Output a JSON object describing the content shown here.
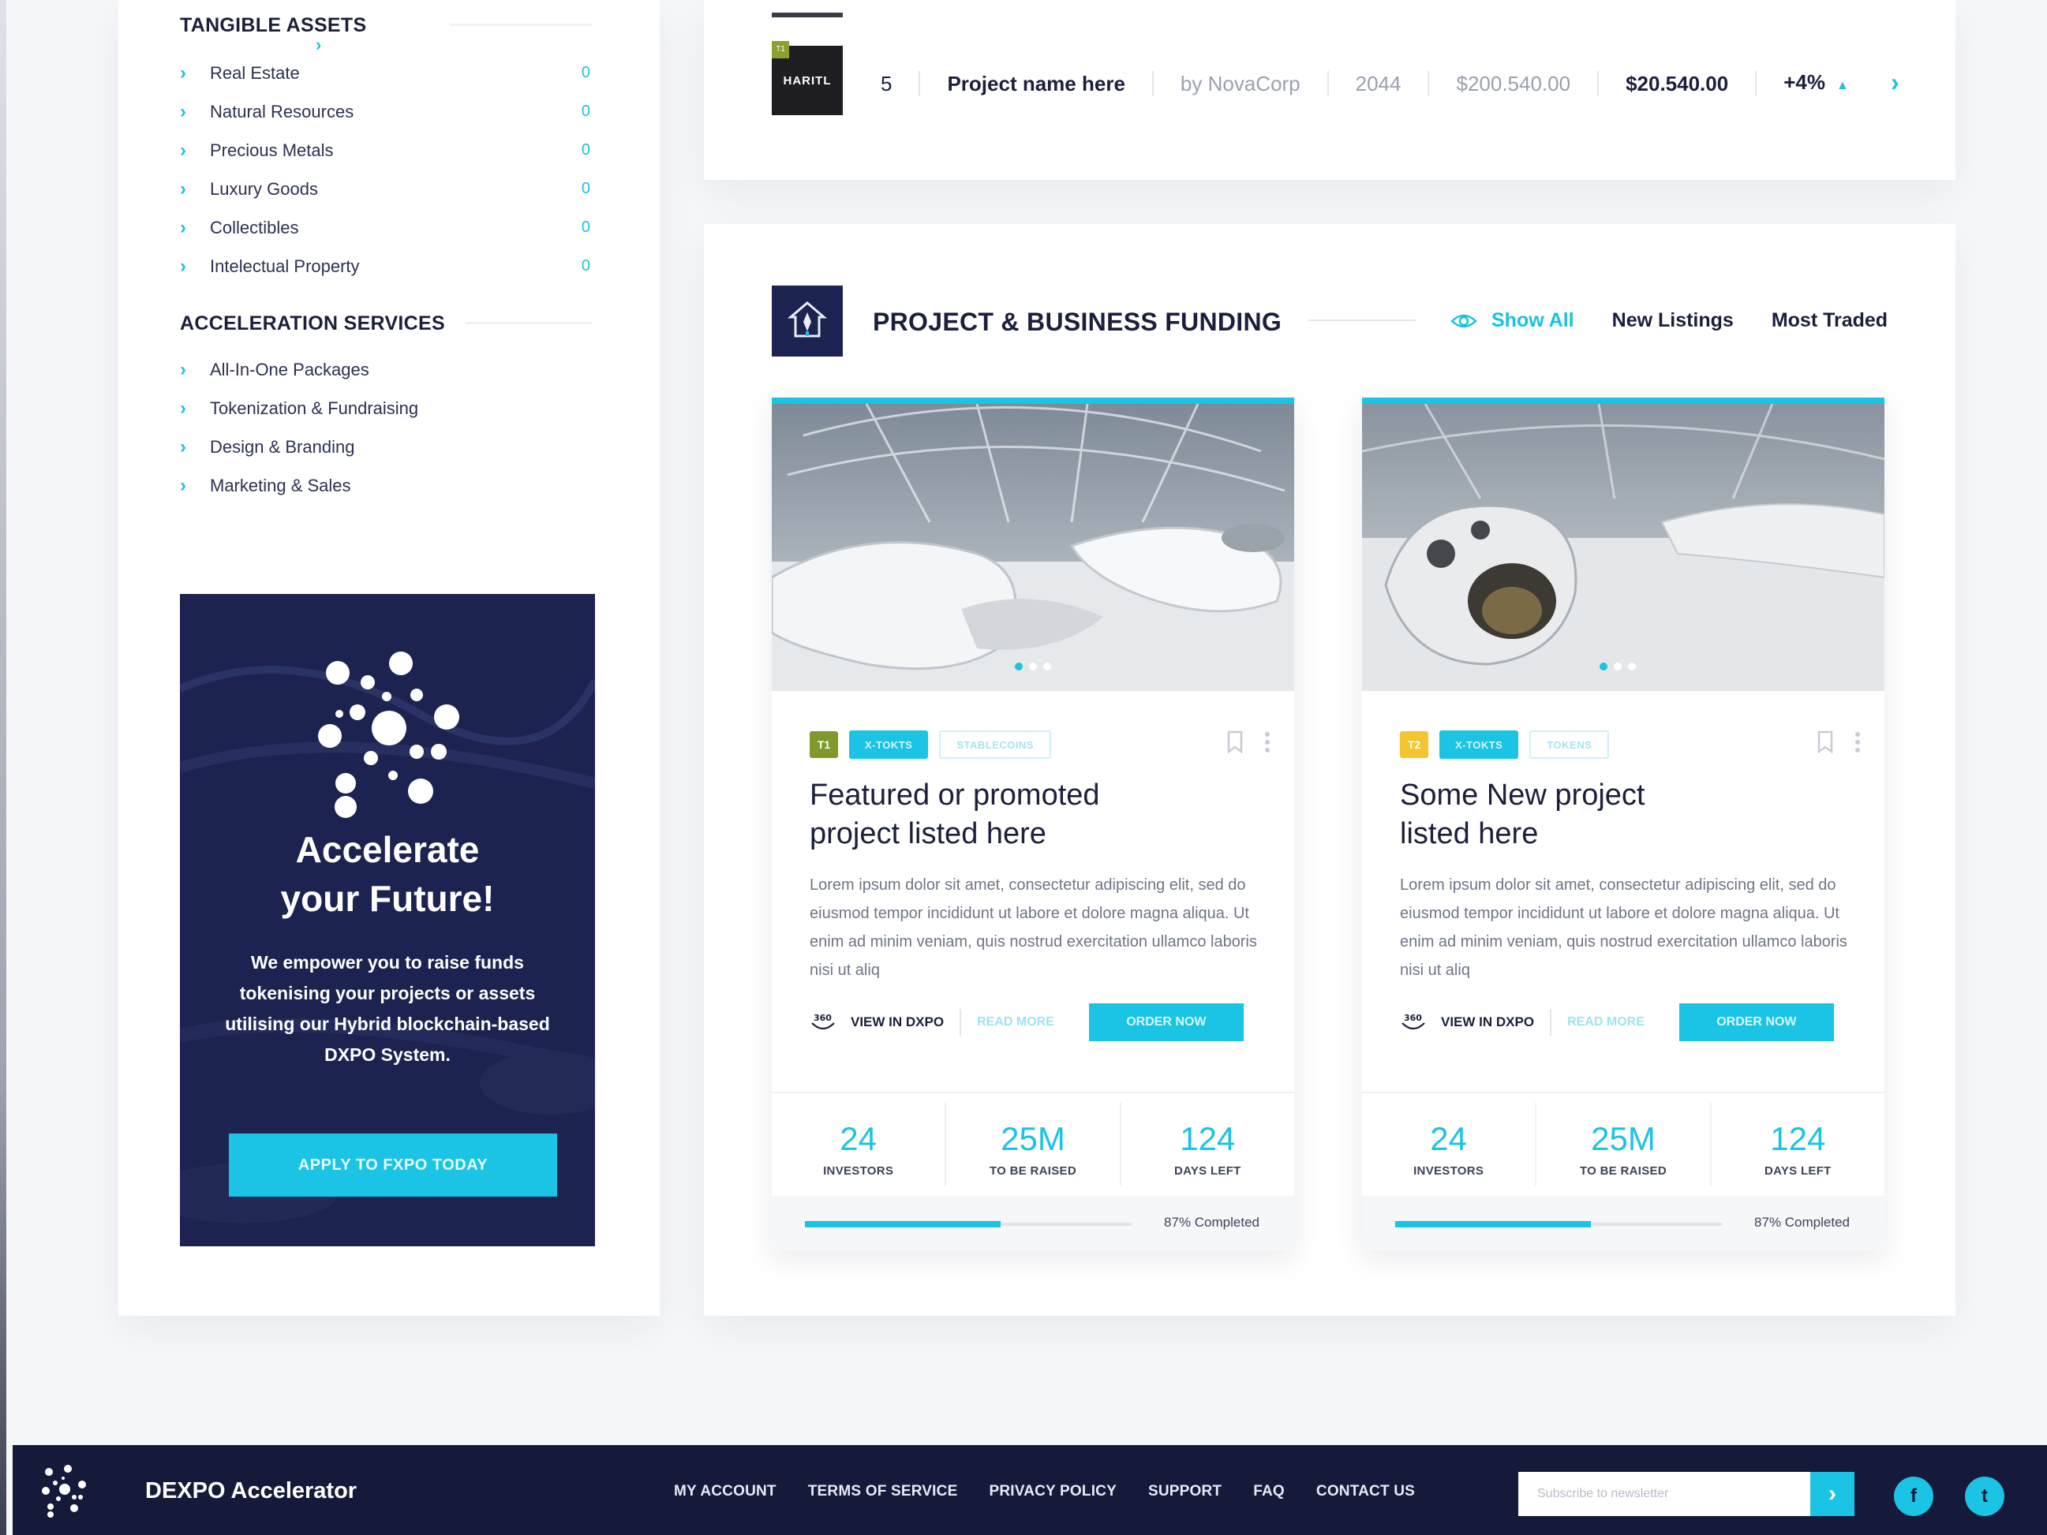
{
  "sidebar": {
    "tangible_title": "TANGIBLE ASSETS",
    "tangible_items": [
      {
        "label": "Real Estate",
        "count": "0"
      },
      {
        "label": "Natural Resources",
        "count": "0"
      },
      {
        "label": "Precious Metals",
        "count": "0"
      },
      {
        "label": "Luxury Goods",
        "count": "0"
      },
      {
        "label": "Collectibles",
        "count": "0"
      },
      {
        "label": "Intelectual Property",
        "count": "0"
      }
    ],
    "acceleration_title": "ACCELERATION SERVICES",
    "acceleration_items": [
      {
        "label": "All-In-One Packages"
      },
      {
        "label": "Tokenization & Fundraising"
      },
      {
        "label": "Design & Branding"
      },
      {
        "label": "Marketing & Sales"
      }
    ]
  },
  "promo": {
    "title": "Accelerate\nyour Future!",
    "text": "We empower you to raise funds tokenising your projects or assets utilising our Hybrid blockchain-based DXPO System.",
    "button": "APPLY TO FXPO TODAY"
  },
  "project_row": {
    "thumb_text": "HARITL",
    "thumb_badge": "T1",
    "rank": "5",
    "name": "Project name here",
    "by": "by NovaCorp",
    "year": "2044",
    "total": "$200.540.00",
    "price": "$20.540.00",
    "change": "+4%"
  },
  "funding": {
    "title": "PROJECT & BUSINESS FUNDING",
    "tabs": {
      "show_all": "Show All",
      "new_listings": "New Listings",
      "most_traded": "Most Traded"
    },
    "cards": [
      {
        "tier": "T1",
        "tier_color": "#7f9a2a",
        "chip1": "X-TOKTS",
        "chip2": "STABLECOINS",
        "title": "Featured or promoted\nproject listed here",
        "desc": "Lorem ipsum dolor sit amet, consectetur adipiscing elit, sed do eiusmod tempor incididunt ut labore et dolore magna aliqua. Ut enim ad minim veniam, quis nostrud exercitation ullamco laboris nisi ut aliq",
        "view": "VIEW IN DXPO",
        "read_more": "READ MORE",
        "order": "ORDER NOW",
        "stats": [
          {
            "value": "24",
            "label": "INVESTORS"
          },
          {
            "value": "25M",
            "label": "TO BE RAISED"
          },
          {
            "value": "124",
            "label": "DAYS LEFT"
          }
        ],
        "progress": 0.6,
        "progress_text": "87% Completed"
      },
      {
        "tier": "T2",
        "tier_color": "#f4c431",
        "chip1": "X-TOKTS",
        "chip2": "TOKENS",
        "title": "Some New project\nlisted here",
        "desc": "Lorem ipsum dolor sit amet, consectetur adipiscing elit, sed do eiusmod tempor incididunt ut labore et dolore magna aliqua. Ut enim ad minim veniam, quis nostrud exercitation ullamco laboris nisi ut aliq",
        "view": "VIEW IN DXPO",
        "read_more": "READ MORE",
        "order": "ORDER NOW",
        "stats": [
          {
            "value": "24",
            "label": "INVESTORS"
          },
          {
            "value": "25M",
            "label": "TO BE RAISED"
          },
          {
            "value": "124",
            "label": "DAYS LEFT"
          }
        ],
        "progress": 0.6,
        "progress_text": "87% Completed"
      }
    ]
  },
  "footer": {
    "brand": "DEXPO Accelerator",
    "nav": [
      "MY ACCOUNT",
      "TERMS OF SERVICE",
      "PRIVACY POLICY",
      "SUPPORT",
      "FAQ",
      "CONTACT US"
    ],
    "newsletter_placeholder": "Subscribe to newsletter",
    "facebook": "f",
    "twitter": "t"
  },
  "colors": {
    "accent": "#1bc3e4",
    "navy": "#1c2350",
    "footer": "#161a3a"
  }
}
